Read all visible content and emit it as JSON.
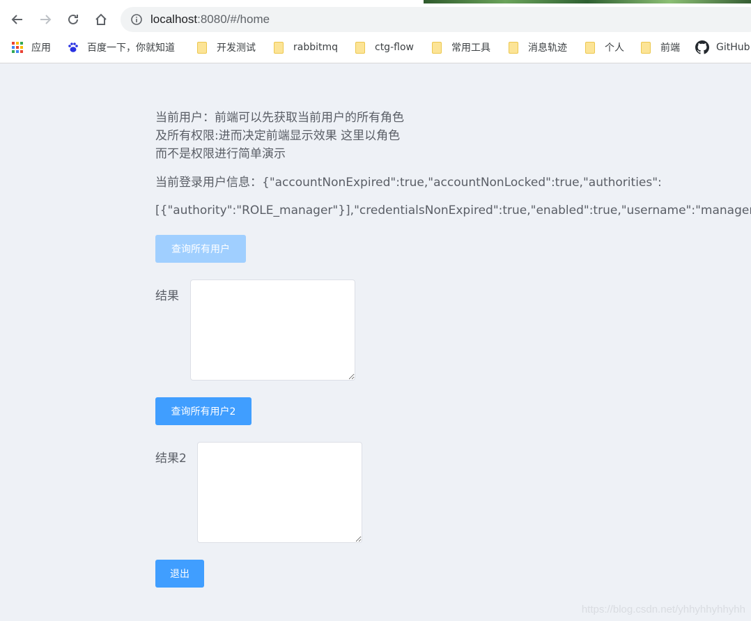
{
  "browser": {
    "url_host": "localhost",
    "url_rest": ":8080/#/home",
    "bookmarks": [
      {
        "label": "应用",
        "icon": "apps-grid-icon"
      },
      {
        "label": "百度一下，你就知道",
        "icon": "baidu-paw-icon"
      },
      {
        "label": "开发测试",
        "icon": "folder-icon"
      },
      {
        "label": "rabbitmq",
        "icon": "folder-icon"
      },
      {
        "label": "ctg-flow",
        "icon": "folder-icon"
      },
      {
        "label": "常用工具",
        "icon": "folder-icon"
      },
      {
        "label": "消息轨迹",
        "icon": "folder-icon"
      },
      {
        "label": "个人",
        "icon": "folder-icon"
      },
      {
        "label": "前端",
        "icon": "folder-icon"
      },
      {
        "label": "GitHub",
        "icon": "github-icon"
      }
    ]
  },
  "page": {
    "description_line1": "当前用户：前端可以先获取当前用户的所有角色",
    "description_line2": "及所有权限:进而决定前端显示效果 这里以角色",
    "description_line3": "而不是权限进行简单演示",
    "userinfo_line1": "当前登录用户信息：{\"accountNonExpired\":true,\"accountNonLocked\":true,\"authorities\":",
    "userinfo_line2": "[{\"authority\":\"ROLE_manager\"}],\"credentialsNonExpired\":true,\"enabled\":true,\"username\":\"manager\"}",
    "query_all_users_label": "查询所有用户",
    "result_label": "结果",
    "result_value": "",
    "query_all_users2_label": "查询所有用户2",
    "result2_label": "结果2",
    "result2_value": "",
    "logout_label": "退出",
    "watermark": "https://blog.csdn.net/yhhyhhyhhyhh"
  },
  "colors": {
    "primary": "#409eff",
    "primary_disabled": "#a0cfff",
    "page_background": "#eef1f6",
    "text": "#5a5e66"
  }
}
